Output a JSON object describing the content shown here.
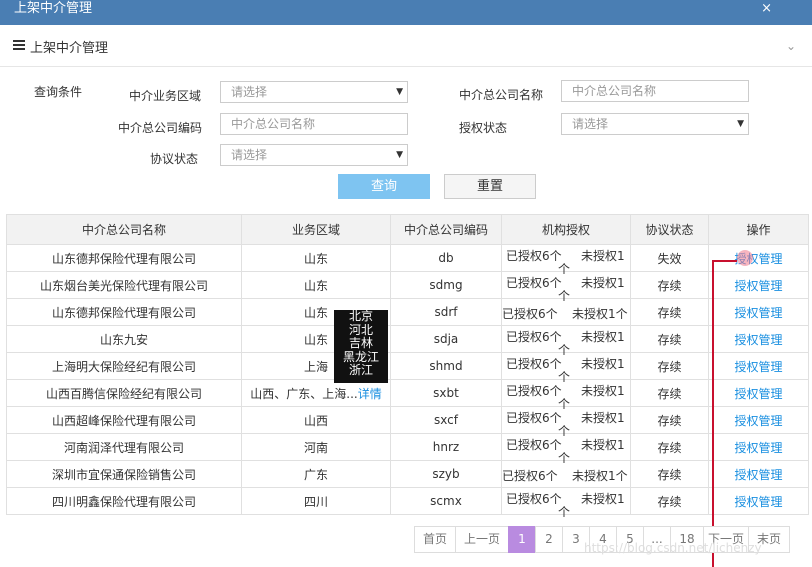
{
  "window": {
    "title": "上架中介管理",
    "close_label": "×"
  },
  "panel": {
    "title": "上架中介管理",
    "collapse_icon": "chevron-down-icon",
    "collapse_glyph": "⌄"
  },
  "search": {
    "section_label": "查询条件",
    "fields": {
      "region_label": "中介业务区域",
      "region_value": "请选择",
      "company_name_label": "中介总公司名称",
      "company_name_placeholder": "中介总公司名称",
      "company_code_label": "中介总公司编码",
      "company_code_placeholder": "中介总公司名称",
      "auth_status_label": "授权状态",
      "auth_status_value": "请选择",
      "agreement_label": "协议状态",
      "agreement_value": "请选择"
    },
    "query_label": "查询",
    "reset_label": "重置"
  },
  "table": {
    "headers": [
      "中介总公司名称",
      "业务区域",
      "中介总公司编码",
      "机构授权",
      "协议状态",
      "操作"
    ],
    "rows": [
      {
        "name": "山东德邦保险代理有限公司",
        "region": "山东",
        "code": "db",
        "authorized": "已授权6个",
        "unauthorized": "未授权1",
        "auth_extra": "个",
        "status": "失效",
        "action": "授权管理"
      },
      {
        "name": "山东烟台美光保险代理有限公司",
        "region": "山东",
        "code": "sdmg",
        "authorized": "已授权6个",
        "unauthorized": "未授权1",
        "auth_extra": "个",
        "status": "存续",
        "action": "授权管理"
      },
      {
        "name": "山东德邦保险代理有限公司",
        "region": "山东",
        "code": "sdrf",
        "authorized": "已授权6个",
        "unauthorized": "未授权1个",
        "auth_extra": "",
        "status": "存续",
        "action": "授权管理"
      },
      {
        "name": "山东九安",
        "region": "山东",
        "code": "sdja",
        "authorized": "已授权6个",
        "unauthorized": "未授权1",
        "auth_extra": "个",
        "status": "存续",
        "action": "授权管理"
      },
      {
        "name": "上海明大保险经纪有限公司",
        "region": "上海",
        "code": "shmd",
        "authorized": "已授权6个",
        "unauthorized": "未授权1",
        "auth_extra": "个",
        "status": "存续",
        "action": "授权管理"
      },
      {
        "name": "山西百腾信保险经纪有限公司",
        "region": "山西、广东、上海...",
        "region_detail": "详情",
        "code": "sxbt",
        "authorized": "已授权6个",
        "unauthorized": "未授权1",
        "auth_extra": "个",
        "status": "存续",
        "action": "授权管理"
      },
      {
        "name": "山西超峰保险代理有限公司",
        "region": "山西",
        "code": "sxcf",
        "authorized": "已授权6个",
        "unauthorized": "未授权1",
        "auth_extra": "个",
        "status": "存续",
        "action": "授权管理"
      },
      {
        "name": "河南润泽代理有限公司",
        "region": "河南",
        "code": "hnrz",
        "authorized": "已授权6个",
        "unauthorized": "未授权1",
        "auth_extra": "个",
        "status": "存续",
        "action": "授权管理"
      },
      {
        "name": "深圳市宜保通保险销售公司",
        "region": "广东",
        "code": "szyb",
        "authorized": "已授权6个",
        "unauthorized": "未授权1个",
        "auth_extra": "",
        "status": "存续",
        "action": "授权管理"
      },
      {
        "name": "四川明鑫保险代理有限公司",
        "region": "四川",
        "code": "scmx",
        "authorized": "已授权6个",
        "unauthorized": "未授权1",
        "auth_extra": "个",
        "status": "存续",
        "action": "授权管理"
      }
    ]
  },
  "tooltip": {
    "lines": [
      "北京",
      "河北",
      "吉林",
      "黑龙江",
      "浙江"
    ]
  },
  "pagination": {
    "items": [
      "首页",
      "上一页",
      "1",
      "2",
      "3",
      "4",
      "5",
      "...",
      "18",
      "下一页",
      "末页"
    ],
    "active": "1"
  },
  "watermark": "https://blog.csdn.net/lichenzy"
}
